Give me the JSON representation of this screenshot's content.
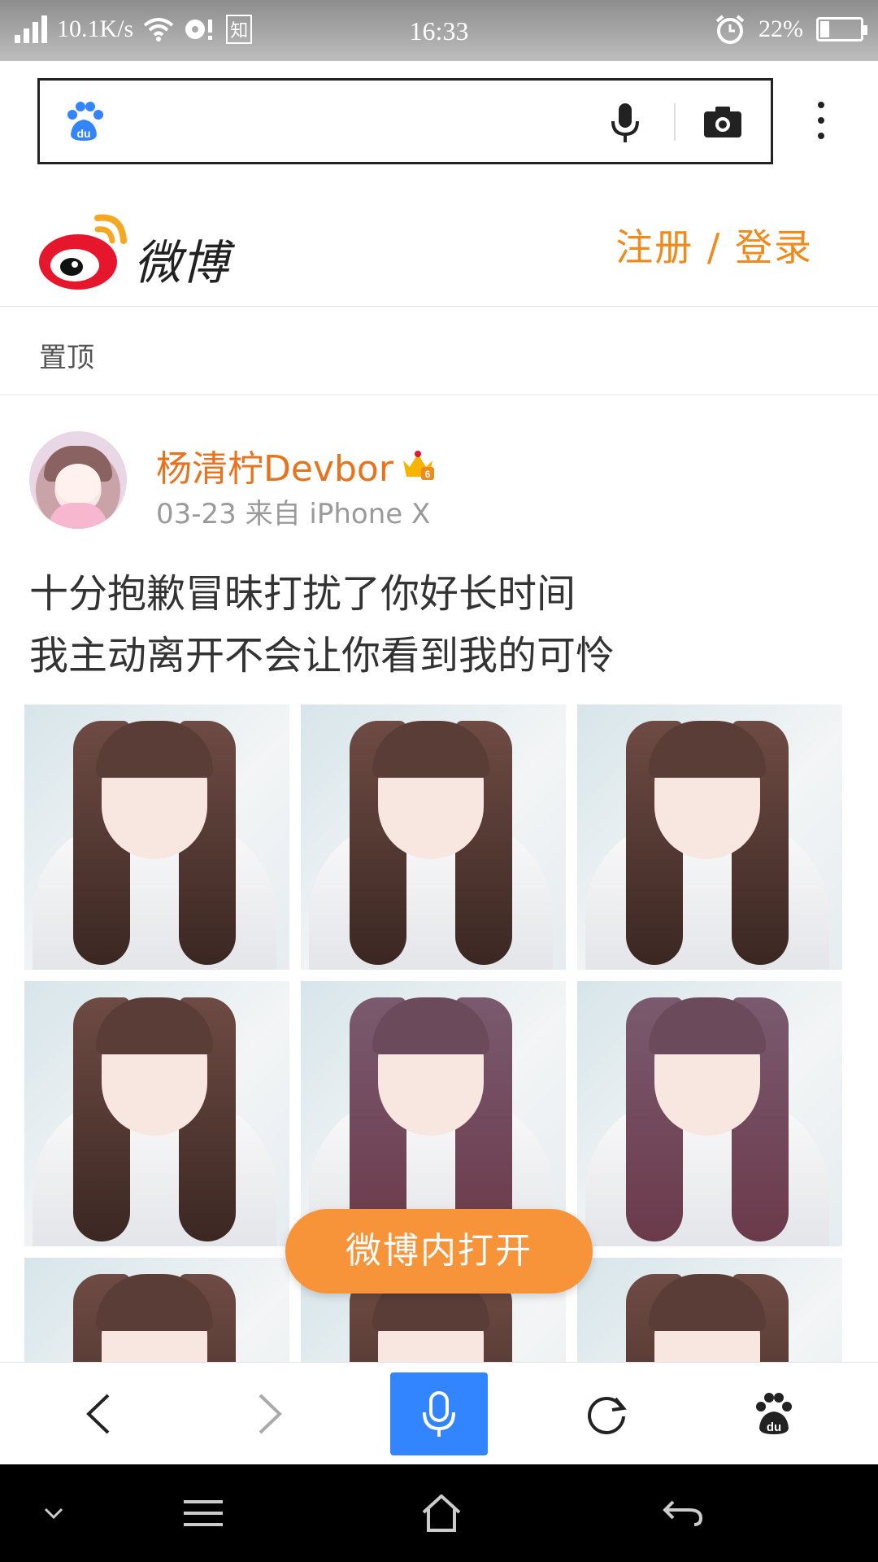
{
  "status_bar": {
    "speed": "10.1K/s",
    "app_badge": "知",
    "time": "16:33",
    "battery_text": "22%",
    "battery_level": 0.22
  },
  "browser": {
    "search_placeholder": "",
    "colors": {
      "brand_blue": "#3385ff"
    }
  },
  "weibo": {
    "logo_text": "微博",
    "auth_link": "注册 / 登录",
    "pinned_label": "置顶",
    "colors": {
      "accent_orange": "#f08a1d"
    }
  },
  "post": {
    "username": "杨清柠Devbor",
    "meta": "03-23 来自 iPhone X",
    "text_line1": "十分抱歉冒昧打扰了你好长时间",
    "text_line2": "我主动离开不会让你看到我的可怜",
    "photo_count_visible": 9
  },
  "open_in_app_button": "微博内打开",
  "toolbar": {
    "back_icon": "chevron-left-icon",
    "forward_icon": "chevron-right-icon",
    "voice_icon": "microphone-icon",
    "refresh_icon": "refresh-icon",
    "home_icon": "baidu-paw-icon"
  },
  "navbar": {
    "icons": [
      "chevron-down-icon",
      "menu-icon",
      "home-icon",
      "back-icon"
    ]
  }
}
